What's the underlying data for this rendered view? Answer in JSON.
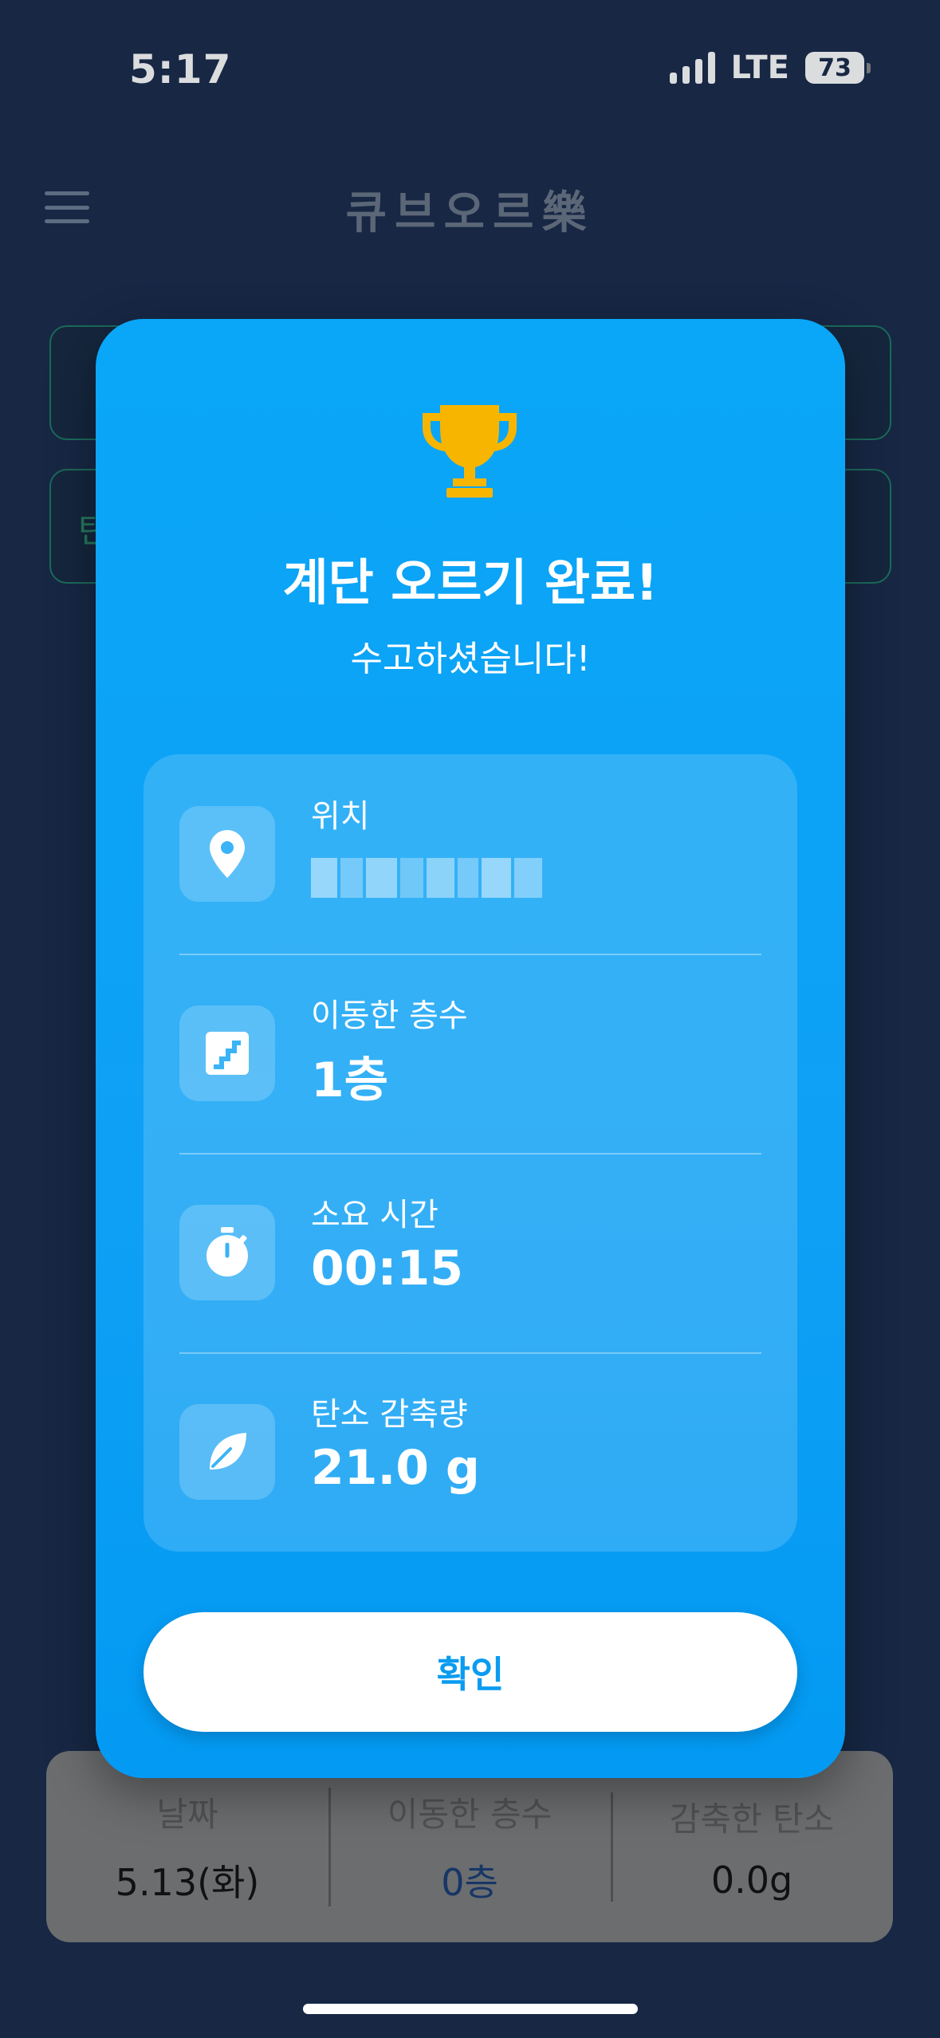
{
  "status_bar": {
    "time": "5:17",
    "network": "LTE",
    "battery": "73"
  },
  "header": {
    "title": "큐브오르樂",
    "menu_icon": "hamburger-icon"
  },
  "background_cards": [
    {
      "text": "탄"
    }
  ],
  "modal": {
    "icon": "trophy-icon",
    "title": "계단 오르기 완료!",
    "subtitle": "수고하셨습니다!",
    "rows": [
      {
        "icon": "location-pin-icon",
        "label": "위치",
        "value": ""
      },
      {
        "icon": "stairs-icon",
        "label": "이동한 층수",
        "value": "1층"
      },
      {
        "icon": "stopwatch-icon",
        "label": "소요 시간",
        "value": "00:15"
      },
      {
        "icon": "leaf-icon",
        "label": "탄소 감축량",
        "value": "21.0 g"
      }
    ],
    "confirm_label": "확인"
  },
  "summary": {
    "date_label": "날짜",
    "date_value": "5.13(화)",
    "floors_label": "이동한 층수",
    "floors_value": "0층",
    "carbon_label": "감축한 탄소",
    "carbon_value": "0.0g"
  },
  "colors": {
    "modal_blue": "#0aa6f7",
    "trophy_gold": "#f7b500",
    "background_navy": "#1a2b4a"
  }
}
